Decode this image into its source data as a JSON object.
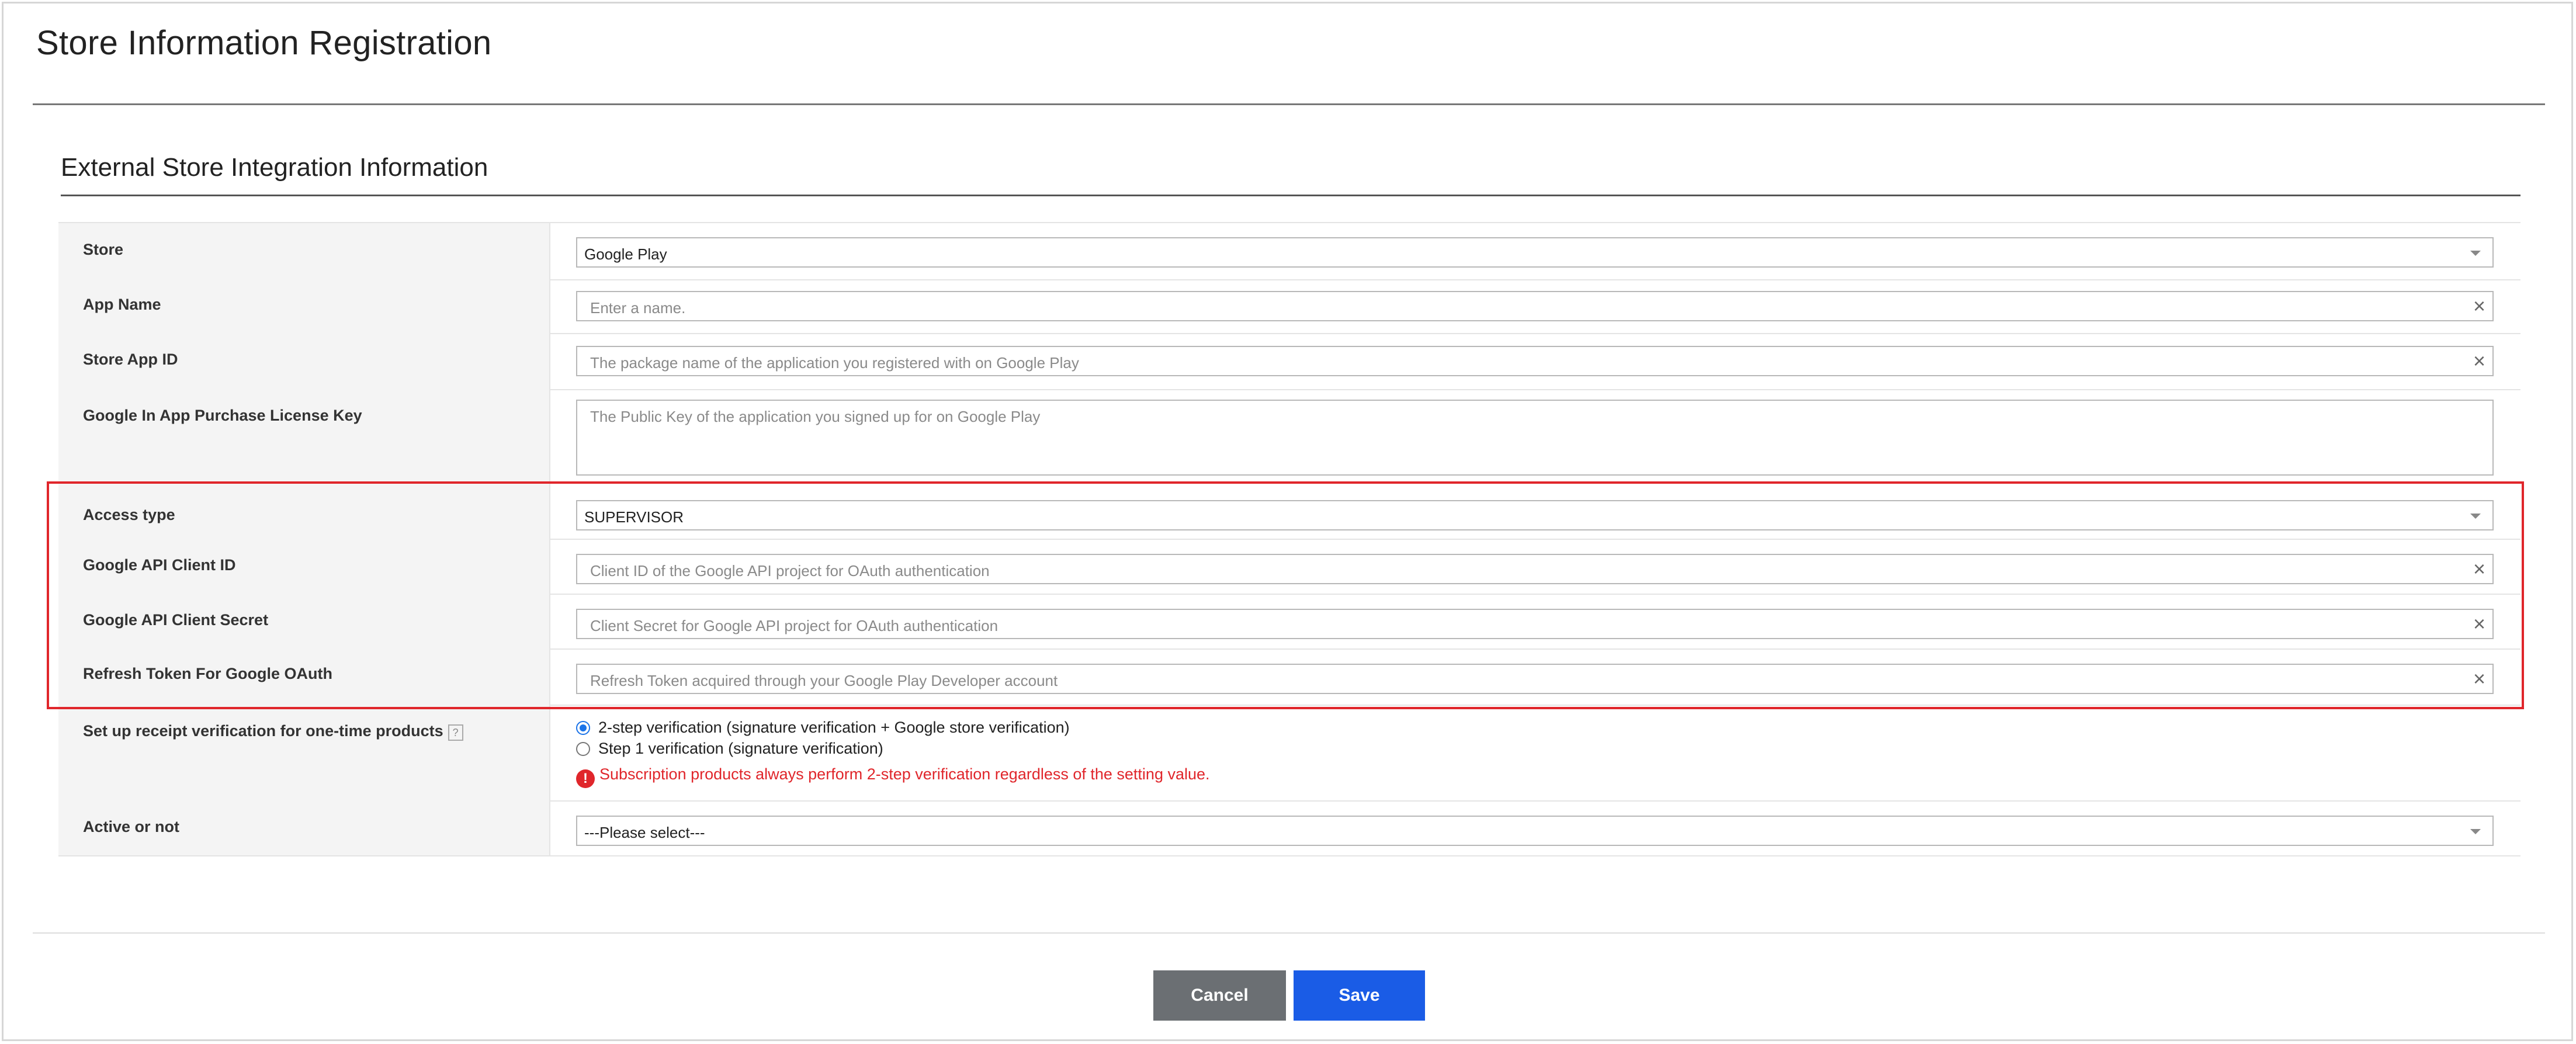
{
  "page_title": "Store Information Registration",
  "section_title": "External Store Integration Information",
  "fields": {
    "store": {
      "label": "Store",
      "value": "Google Play"
    },
    "app_name": {
      "label": "App Name",
      "placeholder": "Enter a name."
    },
    "store_app_id": {
      "label": "Store App ID",
      "placeholder": "The package name of the application you registered with on Google Play"
    },
    "license_key": {
      "label": "Google In App Purchase License Key",
      "placeholder": "The Public Key of the application you signed up for on Google Play"
    },
    "access_type": {
      "label": "Access type",
      "value": "SUPERVISOR"
    },
    "client_id": {
      "label": "Google API Client ID",
      "placeholder": "Client ID of the Google API project for OAuth authentication"
    },
    "client_secret": {
      "label": "Google API Client Secret",
      "placeholder": "Client Secret for Google API project for OAuth authentication"
    },
    "refresh_token": {
      "label": "Refresh Token For Google OAuth",
      "placeholder": "Refresh Token acquired through your Google Play Developer account"
    },
    "receipt_verification": {
      "label": "Set up receipt verification for one-time products",
      "options": [
        {
          "label": "2-step verification (signature verification + Google store verification)",
          "checked": true
        },
        {
          "label": "Step 1 verification (signature verification)",
          "checked": false
        }
      ],
      "warning": "Subscription products always perform 2-step verification regardless of the setting value."
    },
    "active": {
      "label": "Active or not",
      "value": "---Please select---"
    }
  },
  "buttons": {
    "cancel": "Cancel",
    "save": "Save"
  },
  "icons": {
    "help": "question-icon",
    "warning": "exclamation-icon",
    "clear": "clear-x-icon",
    "dropdown": "chevron-down-icon"
  },
  "colors": {
    "highlight": "#e0262b",
    "primary": "#1a5ce6",
    "cancel": "#6b6f73"
  }
}
